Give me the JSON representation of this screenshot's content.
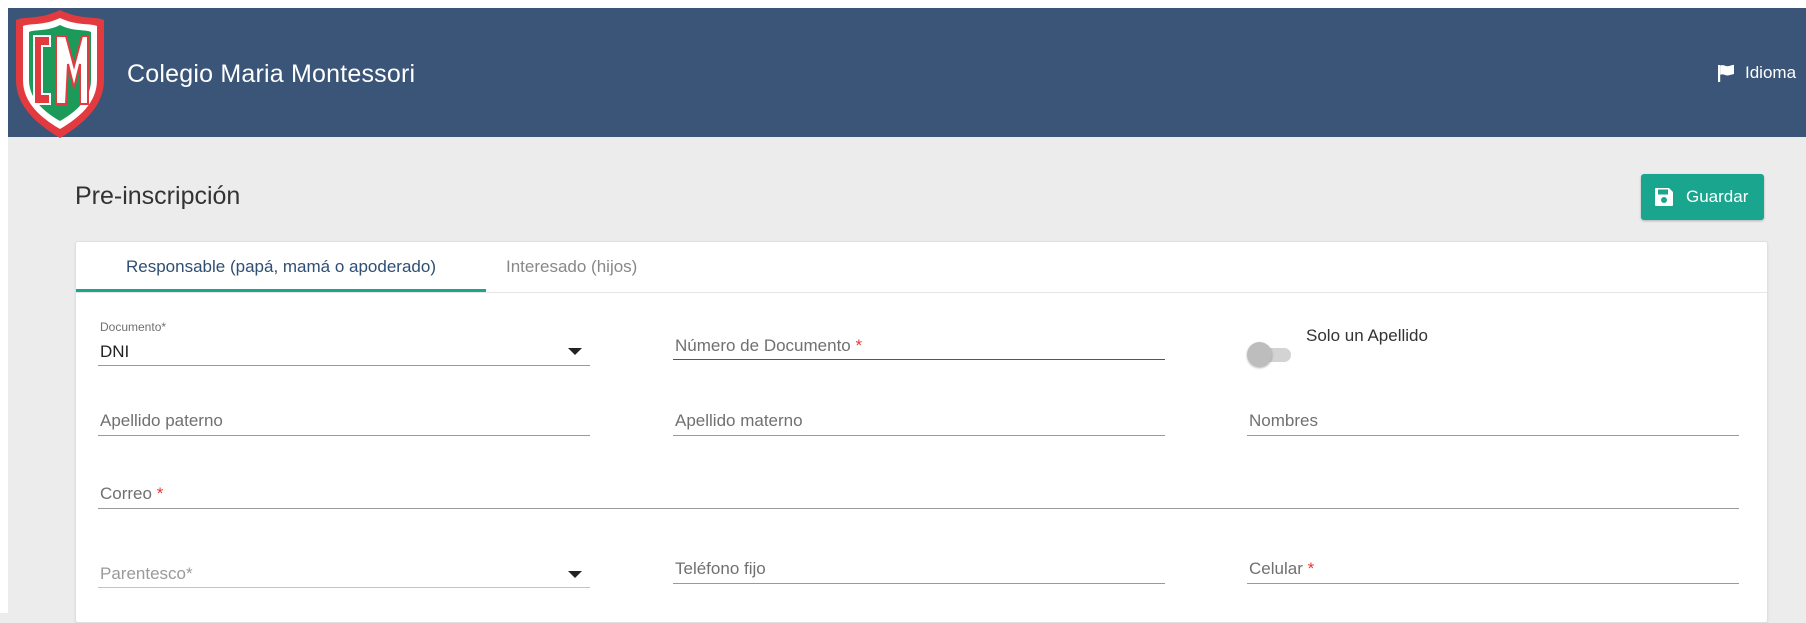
{
  "header": {
    "app_title": "Colegio Maria Montessori",
    "logo_text": "CM",
    "language_label": "Idioma",
    "background_color": "#3a5577"
  },
  "page": {
    "title": "Pre-inscripción",
    "save_label": "Guardar",
    "save_color": "#1aa58f"
  },
  "tabs": [
    {
      "label": "Responsable (papá, mamá o apoderado)",
      "active": true
    },
    {
      "label": "Interesado (hijos)",
      "active": false
    }
  ],
  "form": {
    "documento": {
      "label": "Documento*",
      "value": "DNI"
    },
    "numero_documento": {
      "label": "Número de Documento",
      "required_mark": "*"
    },
    "solo_apellido": {
      "label": "Solo un Apellido",
      "checked": false
    },
    "apellido_paterno": {
      "label": "Apellido paterno"
    },
    "apellido_materno": {
      "label": "Apellido materno"
    },
    "nombres": {
      "label": "Nombres"
    },
    "correo": {
      "label": "Correo",
      "required_mark": "*"
    },
    "parentesco": {
      "placeholder": "Parentesco*"
    },
    "telefono_fijo": {
      "label": "Teléfono fijo"
    },
    "celular": {
      "label": "Celular",
      "required_mark": "*"
    }
  }
}
